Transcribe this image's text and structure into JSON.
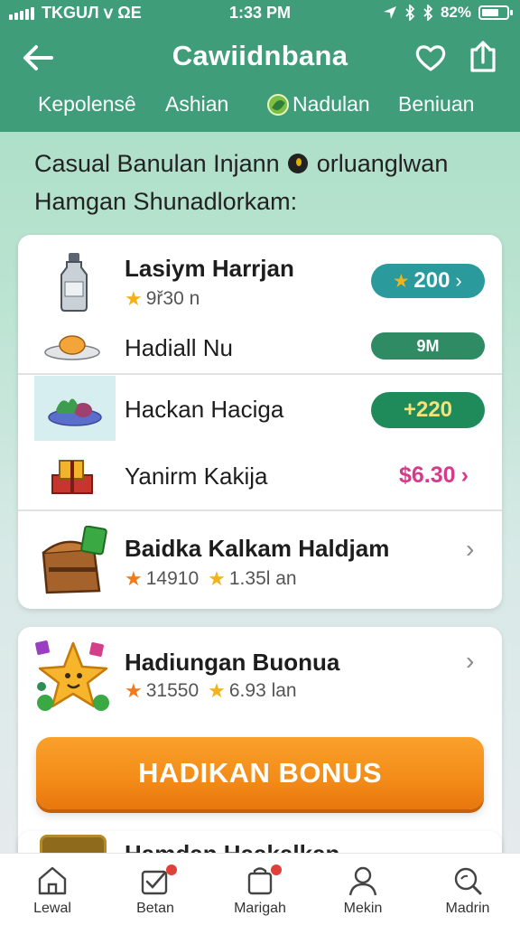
{
  "status_bar": {
    "carrier": "TKGUЛ ⅴ ΩE",
    "time": "1:33 PM",
    "battery": "82%"
  },
  "header": {
    "title": "Cawiidnbana"
  },
  "tabs": [
    "Kepolensê",
    "Ashian",
    "Nadulan",
    "Beniuan"
  ],
  "intro": {
    "line1_a": "Casual Banulan Injann",
    "line1_b": "orluanglwan",
    "line2": "Hamgan Shunadlorkam:"
  },
  "items": [
    {
      "name": "Lasiym Harrjan",
      "sub": "9ř30 n",
      "pill": "200"
    },
    {
      "name": "Hadiall Nu",
      "pill": "9M"
    },
    {
      "name": "Hackan Haciga",
      "pill": "+220"
    },
    {
      "name": "Yanirm Kakija",
      "price": "$6.30"
    },
    {
      "name": "Baidka Kalkam Haldjam",
      "stat1": "14910",
      "stat2": "1.35l an"
    }
  ],
  "bonus_card": {
    "title": "Hadiungan Buonua",
    "stat1": "31550",
    "stat2": "6.93 lan",
    "button": "HADIKAN BONUS"
  },
  "peek": {
    "text": "Hamdan Haakalkan"
  },
  "bottom_nav": [
    "Lewal",
    "Betan",
    "Marigah",
    "Mekin",
    "Madrin"
  ],
  "colors": {
    "header": "#3f9e79",
    "accent_orange": "#f38b18",
    "price": "#d63a8a",
    "pill_teal": "#2a9a9c"
  }
}
